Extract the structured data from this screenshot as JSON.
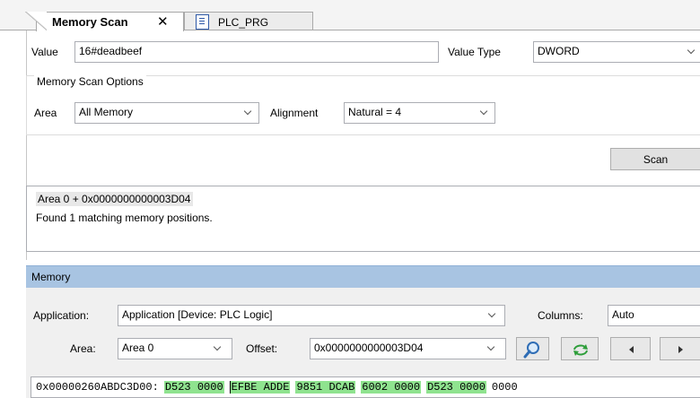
{
  "tabs": [
    {
      "label": "Memory Scan",
      "close": "✕",
      "active": true
    },
    {
      "label": "PLC_PRG",
      "active": false
    }
  ],
  "scan": {
    "value_label": "Value",
    "value": "16#deadbeef",
    "value_type_label": "Value Type",
    "value_type": "DWORD",
    "options_title": "Memory Scan Options",
    "area_label": "Area",
    "area": "All Memory",
    "alignment_label": "Alignment",
    "alignment": "Natural = 4",
    "scan_button": "Scan",
    "results": [
      "Area 0 + 0x0000000000003D04",
      "Found 1 matching memory positions."
    ]
  },
  "memory": {
    "title": "Memory",
    "application_label": "Application:",
    "application": "Application [Device: PLC Logic]",
    "columns_label": "Columns:",
    "columns": "Auto",
    "area_label": "Area:",
    "area": "Area 0",
    "offset_label": "Offset:",
    "offset": "0x0000000000003D04",
    "hex_address": "0x00000260ABDC3D00:",
    "hex_groups": [
      "D523 0000",
      "EFBE ADDE",
      "9851 DCAB",
      "6002 0000",
      "D523 0000",
      "0000"
    ]
  },
  "colors": {
    "accent_header": "#a8c4e2",
    "hex_highlight": "#8fe38f",
    "search_icon": "#2f6db5",
    "refresh_icon": "#2e9e3a"
  },
  "icons": [
    "close-icon",
    "document-icon",
    "search-icon",
    "refresh-icon",
    "arrow-left-icon",
    "arrow-right-icon"
  ]
}
